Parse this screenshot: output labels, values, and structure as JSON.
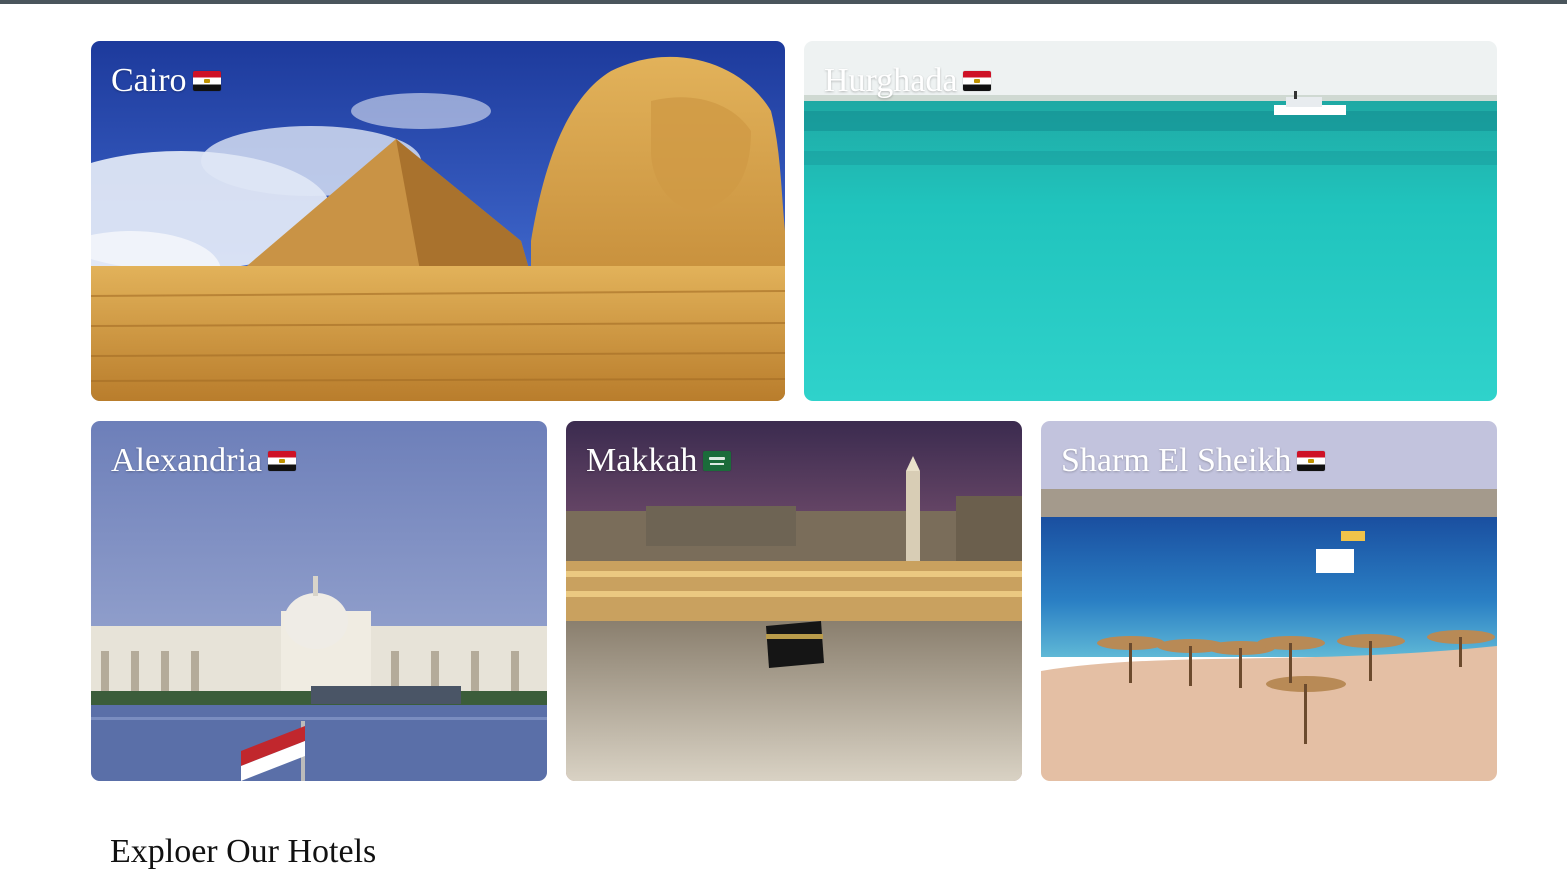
{
  "destinations": [
    {
      "name": "Cairo",
      "flag": "egypt-flag"
    },
    {
      "name": "Hurghada",
      "flag": "egypt-flag"
    },
    {
      "name": "Alexandria",
      "flag": "egypt-flag"
    },
    {
      "name": "Makkah",
      "flag": "saudi-arabia-flag"
    },
    {
      "name": "Sharm El Sheikh",
      "flag": "egypt-flag"
    }
  ],
  "hotels_section": {
    "title": "Exploer Our Hotels"
  },
  "colors": {
    "top_bar": "#4a555c",
    "label_text": "#ffffff",
    "heading_text": "#111111"
  }
}
